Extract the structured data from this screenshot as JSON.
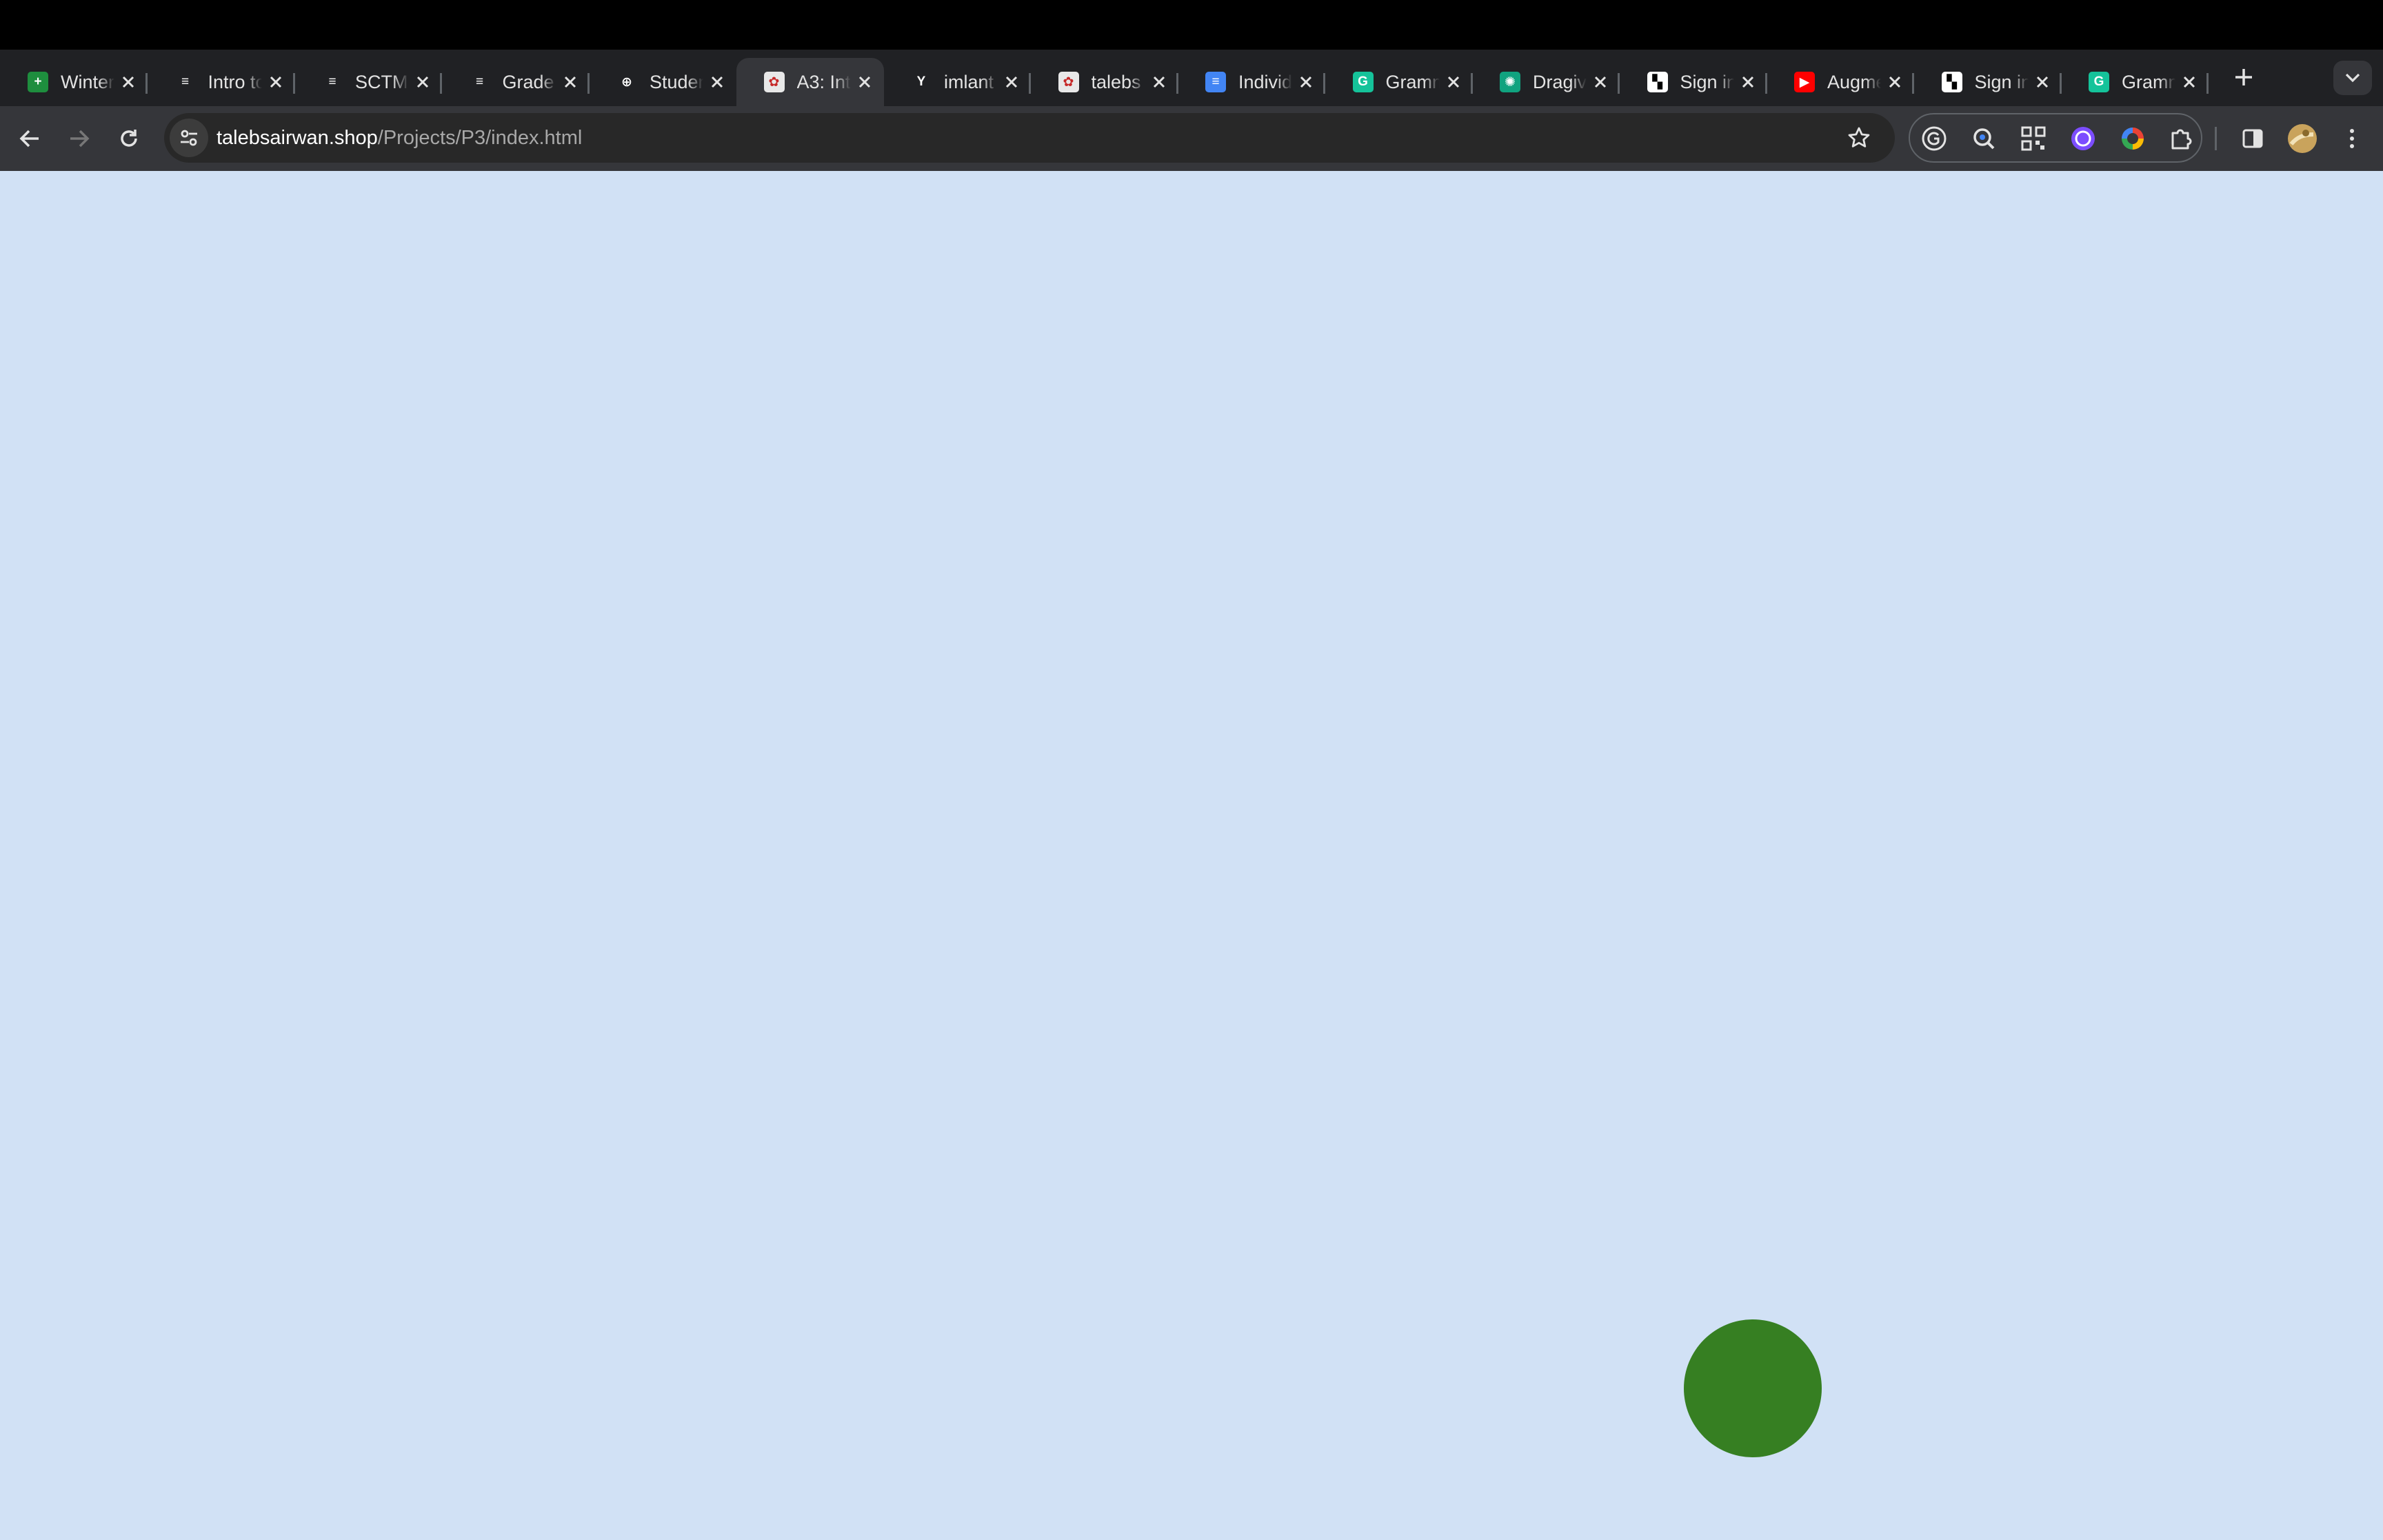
{
  "browser": {
    "tabs": [
      {
        "label": "Winter",
        "favicon": "sheets-icon",
        "favicon_color": "#1e8e3e",
        "favicon_glyph": "+"
      },
      {
        "label": "Intro to",
        "favicon": "gradescope-icon",
        "favicon_color": "#202124",
        "favicon_glyph": "≡"
      },
      {
        "label": "SCTM",
        "favicon": "gradescope-icon",
        "favicon_color": "#202124",
        "favicon_glyph": "≡"
      },
      {
        "label": "Grade",
        "favicon": "gradescope-icon",
        "favicon_color": "#202124",
        "favicon_glyph": "≡"
      },
      {
        "label": "Studen",
        "favicon": "globe-icon",
        "favicon_color": "#202124",
        "favicon_glyph": "⊕"
      },
      {
        "label": "A3: Int",
        "favicon": "site-icon",
        "favicon_color": "#e8e8e8",
        "favicon_glyph": "✿",
        "active": true
      },
      {
        "label": "imlant",
        "favicon": "ycombinator-icon",
        "favicon_color": "#202124",
        "favicon_glyph": "Y"
      },
      {
        "label": "talebs",
        "favicon": "site-icon",
        "favicon_color": "#e8e8e8",
        "favicon_glyph": "✿"
      },
      {
        "label": "Individ",
        "favicon": "docs-icon",
        "favicon_color": "#4285f4",
        "favicon_glyph": "≡"
      },
      {
        "label": "Gramm",
        "favicon": "grammarly-icon",
        "favicon_color": "#15c39a",
        "favicon_glyph": "G"
      },
      {
        "label": "Dragiv",
        "favicon": "openai-icon",
        "favicon_color": "#10a37f",
        "favicon_glyph": "✺"
      },
      {
        "label": "Sign in",
        "favicon": "checker-icon",
        "favicon_color": "#ffffff",
        "favicon_glyph": "▚"
      },
      {
        "label": "Augme",
        "favicon": "youtube-icon",
        "favicon_color": "#ff0000",
        "favicon_glyph": "▶"
      },
      {
        "label": "Sign in",
        "favicon": "checker-icon",
        "favicon_color": "#ffffff",
        "favicon_glyph": "▚"
      },
      {
        "label": "Gramm",
        "favicon": "grammarly-icon",
        "favicon_color": "#15c39a",
        "favicon_glyph": "G"
      }
    ],
    "url_host": "talebsairwan.shop",
    "url_path": "/Projects/P3/index.html",
    "extensions": [
      "grammarly-extension-icon",
      "lens-extension-icon",
      "qr-extension-icon",
      "ai-extension-icon",
      "color-picker-extension-icon",
      "extensions-puzzle-icon"
    ]
  },
  "page": {
    "background_color": "#d1e1f5",
    "ball_color": "#367f22"
  }
}
